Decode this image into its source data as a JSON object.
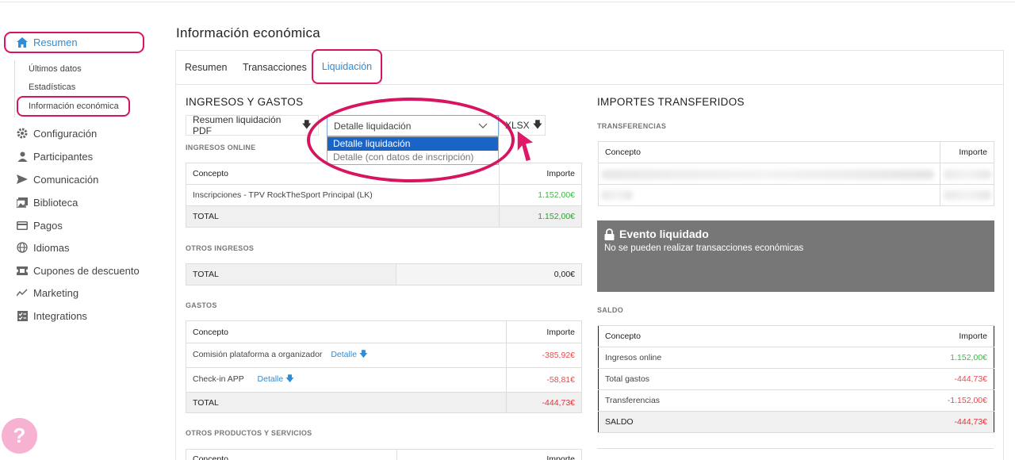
{
  "sidebar": {
    "main": {
      "label": "Resumen",
      "icon": "home-icon"
    },
    "sub": [
      "Últimos datos",
      "Estadísticas",
      "Información económica"
    ],
    "items": [
      {
        "label": "Configuración",
        "icon": "gear-icon"
      },
      {
        "label": "Participantes",
        "icon": "user-icon"
      },
      {
        "label": "Comunicación",
        "icon": "send-icon"
      },
      {
        "label": "Biblioteca",
        "icon": "images-icon"
      },
      {
        "label": "Pagos",
        "icon": "card-icon"
      },
      {
        "label": "Idiomas",
        "icon": "globe-icon"
      },
      {
        "label": "Cupones de descuento",
        "icon": "ticket-icon"
      },
      {
        "label": "Marketing",
        "icon": "trend-icon"
      },
      {
        "label": "Integrations",
        "icon": "checklist-icon"
      }
    ],
    "help": "?"
  },
  "page": {
    "title": "Información económica"
  },
  "tabs": [
    "Resumen",
    "Transacciones",
    "Liquidación"
  ],
  "left": {
    "title": "INGRESOS Y GASTOS",
    "pdf_button": "Resumen liquidación PDF",
    "select_value": "Detalle liquidación",
    "select_options": [
      "Detalle liquidación",
      "Detalle (con datos de inscripción)"
    ],
    "xlsx_button": "XLSX",
    "online": {
      "title": "INGRESOS ONLINE",
      "headers": [
        "Concepto",
        "Importe"
      ],
      "rows": [
        [
          "Inscripciones - TPV RockTheSport Principal (LK)",
          "1.152,00€"
        ]
      ],
      "total": [
        "TOTAL",
        "1.152,00€"
      ]
    },
    "otros": {
      "title": "OTROS INGRESOS",
      "total": [
        "TOTAL",
        "0,00€"
      ]
    },
    "gastos": {
      "title": "GASTOS",
      "headers": [
        "Concepto",
        "Importe"
      ],
      "rows": [
        {
          "concept": "Comisión plataforma a organizador",
          "link": "Detalle",
          "amount": "-385,92€"
        },
        {
          "concept": "Check-in APP",
          "link": "Detalle",
          "amount": "-58,81€"
        }
      ],
      "total": [
        "TOTAL",
        "-444,73€"
      ]
    },
    "productos": {
      "title": "OTROS PRODUCTOS Y SERVICIOS",
      "headers": [
        "Concepto",
        "Importe"
      ]
    }
  },
  "right": {
    "title": "IMPORTES TRANSFERIDOS",
    "transfer_title": "TRANSFERENCIAS",
    "transfer_headers": [
      "Concepto",
      "Importe"
    ],
    "locked_title": "Evento liquidado",
    "locked_text": "No se pueden realizar transacciones económicas",
    "saldo_title": "SALDO",
    "saldo_headers": [
      "Concepto",
      "Importe"
    ],
    "saldo_rows": [
      [
        "Ingresos online",
        "1.152,00€"
      ],
      [
        "Total gastos",
        "-444,73€"
      ],
      [
        "Transferencias",
        "-1.152,00€"
      ]
    ],
    "saldo_total": [
      "SALDO",
      "-444,73€"
    ]
  },
  "colors": {
    "accent": "#2d8dd6",
    "highlight": "#d6145f",
    "positive": "#43b649",
    "negative": "#e54c4c"
  }
}
